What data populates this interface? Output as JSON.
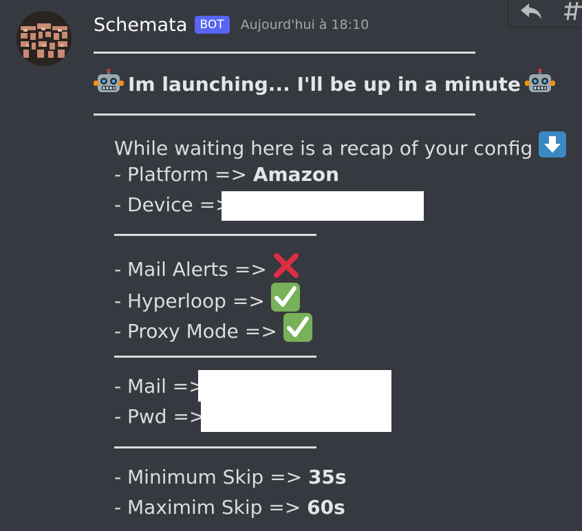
{
  "message": {
    "author": "Schemata",
    "bot_tag": "BOT",
    "timestamp": "Aujourd'hui à 18:10",
    "separator_long": "---------------------------------------------",
    "separator_short": "------------------------",
    "title": "Im launching... I'll be up in a minute",
    "recap_intro": "While waiting here is a recap of your config",
    "platform_label": "- Platform =>",
    "platform_value": "Amazon",
    "device_label": "- Device =>",
    "mail_alerts_label": "- Mail Alerts =>",
    "hyperloop_label": "- Hyperloop =>",
    "proxy_mode_label": "- Proxy Mode =>",
    "mail_label": "- Mail =>",
    "pwd_label": "- Pwd =>",
    "min_skip_label": "- Minimum Skip =>",
    "min_skip_value": "35s",
    "max_skip_label": "- Maximim Skip =>",
    "max_skip_value": "60s"
  },
  "icons": {
    "title_emoji": "robot-icon",
    "intro_emoji": "down-arrow-icon",
    "mail_alerts_status": "cross-mark-icon",
    "hyperloop_status": "check-mark-icon",
    "proxy_mode_status": "check-mark-icon",
    "toolbar_reply": "reply-icon",
    "toolbar_thread": "thread-icon"
  },
  "colors": {
    "background": "#36393f",
    "bot_tag": "#5865f2",
    "check_green": "#78b159",
    "cross_red": "#dd2e44",
    "arrow_blue": "#3b88c3"
  }
}
